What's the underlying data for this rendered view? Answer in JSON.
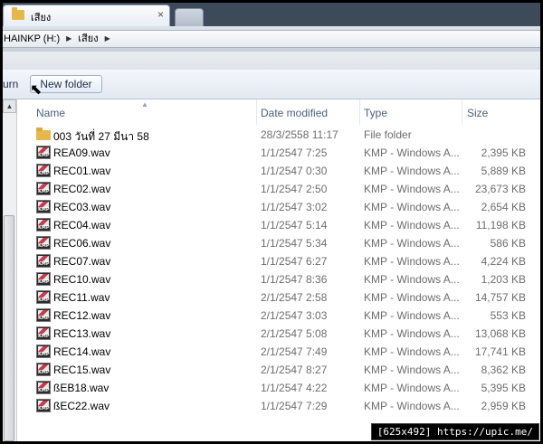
{
  "window": {
    "tab_title": "เสียง",
    "tab_close": "×"
  },
  "address": {
    "drive": "HAINKP (H:)",
    "folder": "เสียง",
    "sep": "▶"
  },
  "toolbar": {
    "cut_left_text": "urn",
    "new_folder_label": "New folder"
  },
  "columns": {
    "name": "Name",
    "date": "Date modified",
    "type": "Type",
    "size": "Size"
  },
  "files": [
    {
      "name": "003 วันที่ 27 มีนา 58",
      "date": "28/3/2558 11:17",
      "type": "File folder",
      "size": "",
      "icon": "folder-icon"
    },
    {
      "name": "REA09.wav",
      "date": "1/1/2547 7:25",
      "type": "KMP - Windows A...",
      "size": "2,395 KB",
      "icon": "kmp-audio-icon"
    },
    {
      "name": "REC01.wav",
      "date": "1/1/2547 0:30",
      "type": "KMP - Windows A...",
      "size": "5,889 KB",
      "icon": "kmp-audio-icon"
    },
    {
      "name": "REC02.wav",
      "date": "1/1/2547 2:50",
      "type": "KMP - Windows A...",
      "size": "23,673 KB",
      "icon": "kmp-audio-icon"
    },
    {
      "name": "REC03.wav",
      "date": "1/1/2547 3:02",
      "type": "KMP - Windows A...",
      "size": "2,654 KB",
      "icon": "kmp-audio-icon"
    },
    {
      "name": "REC04.wav",
      "date": "1/1/2547 5:14",
      "type": "KMP - Windows A...",
      "size": "11,198 KB",
      "icon": "kmp-audio-icon"
    },
    {
      "name": "REC06.wav",
      "date": "1/1/2547 5:34",
      "type": "KMP - Windows A...",
      "size": "586 KB",
      "icon": "kmp-audio-icon"
    },
    {
      "name": "REC07.wav",
      "date": "1/1/2547 6:27",
      "type": "KMP - Windows A...",
      "size": "4,224 KB",
      "icon": "kmp-audio-icon"
    },
    {
      "name": "REC10.wav",
      "date": "1/1/2547 8:36",
      "type": "KMP - Windows A...",
      "size": "1,203 KB",
      "icon": "kmp-audio-icon"
    },
    {
      "name": "REC11.wav",
      "date": "2/1/2547 2:58",
      "type": "KMP - Windows A...",
      "size": "14,757 KB",
      "icon": "kmp-audio-icon"
    },
    {
      "name": "REC12.wav",
      "date": "2/1/2547 3:03",
      "type": "KMP - Windows A...",
      "size": "553 KB",
      "icon": "kmp-audio-icon"
    },
    {
      "name": "REC13.wav",
      "date": "2/1/2547 5:08",
      "type": "KMP - Windows A...",
      "size": "13,068 KB",
      "icon": "kmp-audio-icon"
    },
    {
      "name": "REC14.wav",
      "date": "2/1/2547 7:49",
      "type": "KMP - Windows A...",
      "size": "17,741 KB",
      "icon": "kmp-audio-icon"
    },
    {
      "name": "REC15.wav",
      "date": "2/1/2547 8:27",
      "type": "KMP - Windows A...",
      "size": "8,362 KB",
      "icon": "kmp-audio-icon"
    },
    {
      "name": "ßEB18.wav",
      "date": "1/1/2547 4:22",
      "type": "KMP - Windows A...",
      "size": "5,395 KB",
      "icon": "kmp-audio-icon"
    },
    {
      "name": "ßEC22.wav",
      "date": "1/1/2547 7:29",
      "type": "KMP - Windows A...",
      "size": "2,959 KB",
      "icon": "kmp-audio-icon"
    }
  ],
  "watermark": "[625x492] https://upic.me/"
}
